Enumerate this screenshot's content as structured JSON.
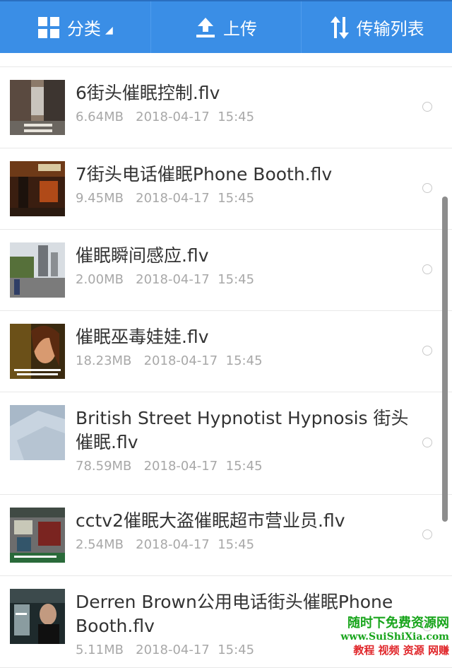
{
  "toolbar": {
    "category_label": "分类",
    "upload_label": "上传",
    "transfer_label": "传输列表"
  },
  "files": [
    {
      "name": "6街头催眠控制.flv",
      "size": "6.64MB",
      "date": "2018-04-17",
      "time": "15:45"
    },
    {
      "name": "7街头电话催眠Phone Booth.flv",
      "size": "9.45MB",
      "date": "2018-04-17",
      "time": "15:45"
    },
    {
      "name": "催眠瞬间感应.flv",
      "size": "2.00MB",
      "date": "2018-04-17",
      "time": "15:45"
    },
    {
      "name": "催眠巫毒娃娃.flv",
      "size": "18.23MB",
      "date": "2018-04-17",
      "time": "15:45"
    },
    {
      "name": "British Street Hypnotist Hypnosis 街头催眠.flv",
      "size": "78.59MB",
      "date": "2018-04-17",
      "time": "15:45"
    },
    {
      "name": "cctv2催眠大盗催眠超市营业员.flv",
      "size": "2.54MB",
      "date": "2018-04-17",
      "time": "15:45"
    },
    {
      "name": "Derren Brown公用电话街头催眠Phone Booth.flv",
      "size": "5.11MB",
      "date": "2018-04-17",
      "time": "15:45"
    }
  ],
  "watermark": {
    "line1": "随时下免费资源网",
    "line2": "www.SuiShiXia.com",
    "line3": "教程 视频 资源 网赚"
  },
  "colors": {
    "accent": "#3a8ee6",
    "text": "#333333",
    "meta": "#a8a8a8"
  }
}
